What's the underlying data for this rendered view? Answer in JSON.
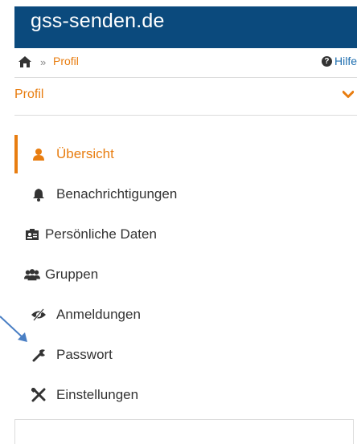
{
  "banner": {
    "title": "gss-senden.de"
  },
  "breadcrumb": {
    "separator": "»",
    "current": "Profil",
    "help_label": "Hilfe"
  },
  "section": {
    "title": "Profil"
  },
  "nav": {
    "items": [
      {
        "label": "Übersicht",
        "icon": "user-icon",
        "active": true
      },
      {
        "label": "Benachrichtigungen",
        "icon": "bell-icon"
      },
      {
        "label": "Persönliche Daten",
        "icon": "id-card-icon"
      },
      {
        "label": "Gruppen",
        "icon": "users-icon"
      },
      {
        "label": "Anmeldungen",
        "icon": "eye-slash-icon"
      },
      {
        "label": "Passwort",
        "icon": "wrench-icon"
      },
      {
        "label": "Einstellungen",
        "icon": "tools-icon"
      }
    ]
  },
  "colors": {
    "accent": "#e87d10",
    "banner": "#0b4a7d",
    "link": "#1f6fb0",
    "arrow": "#4a7fc4"
  }
}
